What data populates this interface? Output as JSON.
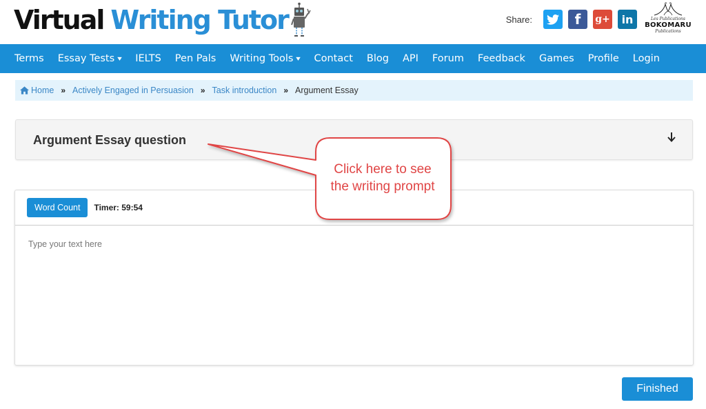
{
  "header": {
    "logo_part1": "Virtual",
    "logo_part2": "Writing Tutor",
    "share_label": "Share:",
    "social": [
      {
        "name": "twitter",
        "glyph": "t"
      },
      {
        "name": "facebook",
        "glyph": "f"
      },
      {
        "name": "google-plus",
        "glyph": "g+"
      },
      {
        "name": "linkedin",
        "glyph": "in"
      }
    ],
    "publisher": {
      "line1": "Les Publications",
      "name": "BOKOMARU",
      "line2": "Publications"
    }
  },
  "nav": {
    "items": [
      {
        "label": "Terms",
        "dropdown": false
      },
      {
        "label": "Essay Tests",
        "dropdown": true
      },
      {
        "label": "IELTS",
        "dropdown": false
      },
      {
        "label": "Pen Pals",
        "dropdown": false
      },
      {
        "label": "Writing Tools",
        "dropdown": true
      },
      {
        "label": "Contact",
        "dropdown": false
      },
      {
        "label": "Blog",
        "dropdown": false
      },
      {
        "label": "API",
        "dropdown": false
      },
      {
        "label": "Forum",
        "dropdown": false
      },
      {
        "label": "Feedback",
        "dropdown": false
      },
      {
        "label": "Games",
        "dropdown": false
      },
      {
        "label": "Profile",
        "dropdown": false
      },
      {
        "label": "Login",
        "dropdown": false
      }
    ],
    "dropdown_glyph": "❯"
  },
  "breadcrumb": {
    "home": "Home",
    "separator": "»",
    "links": [
      "Actively Engaged in Persuasion",
      "Task introduction"
    ],
    "current": "Argument Essay"
  },
  "question": {
    "title": "Argument Essay question"
  },
  "editor": {
    "word_count_label": "Word Count",
    "timer_label": "Timer: 59:54",
    "placeholder": "Type your text here",
    "value": ""
  },
  "finished_label": "Finished",
  "callout": {
    "line1": "Click here to see",
    "line2": "the writing prompt",
    "color": "#e04545"
  },
  "colors": {
    "brand_blue": "#1a8ed6",
    "breadcrumb_bg": "#e4f3fc",
    "link": "#3b87c6"
  }
}
